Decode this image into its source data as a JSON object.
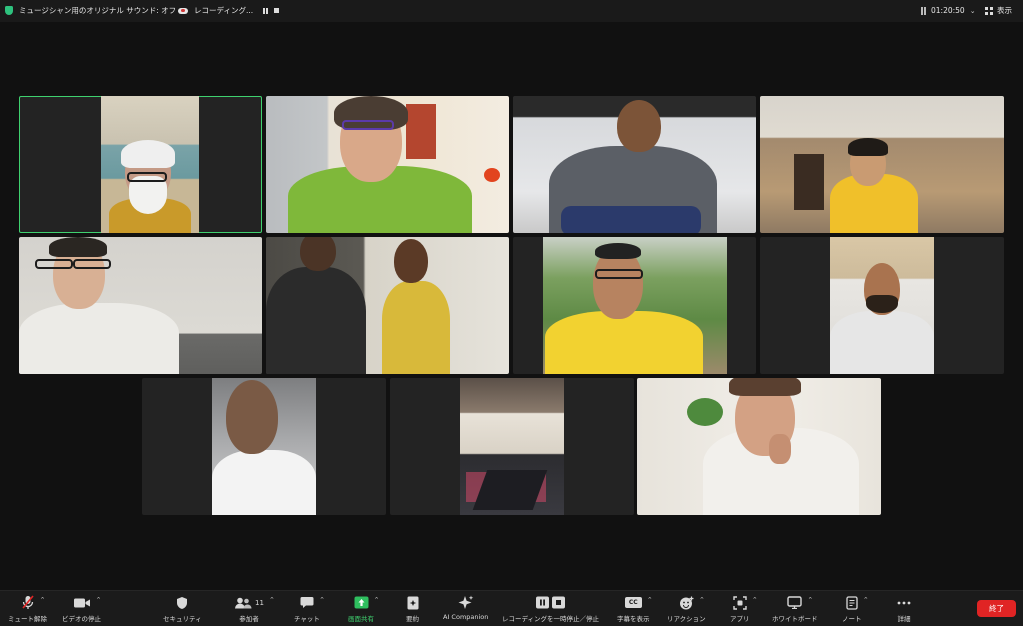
{
  "topbar": {
    "sound_label": "ミュージシャン用のオリジナル サウンド: オフ",
    "recording_label": "レコーディング...",
    "timer": "01:20:50",
    "view_label": "表示"
  },
  "participants_count": "11",
  "toolbar": {
    "mute": "ミュート解除",
    "video": "ビデオの停止",
    "security": "セキュリティ",
    "participants": "参加者",
    "chat": "チャット",
    "share": "画面共有",
    "summary": "要約",
    "ai": "AI Companion",
    "recording": "レコーディングを一時停止／停止",
    "captions": "字幕を表示",
    "reactions": "リアクション",
    "apps": "アプリ",
    "whiteboard": "ホワイトボード",
    "notes": "ノート",
    "more": "詳細",
    "end": "終了",
    "cc_glyph": "CC"
  },
  "colors": {
    "accent_green": "#3fd16f",
    "end_red": "#e02424",
    "background": "#111111"
  }
}
